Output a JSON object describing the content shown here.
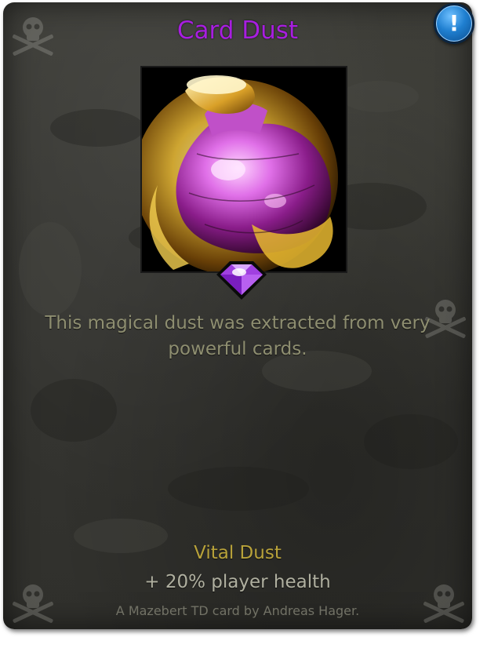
{
  "card": {
    "title": "Card Dust",
    "description": "This magical dust was extracted from very powerful cards.",
    "effect_name": "Vital Dust",
    "effect_description": "+ 20% player health",
    "credit": "A Mazebert TD card by Andreas Hager."
  },
  "info_button": {
    "label": "!",
    "icon": "exclamation-icon"
  },
  "icons": {
    "art": "potion-flask-icon",
    "rarity": "purple-gem-icon",
    "corners": "skull-crossbones-icon"
  },
  "colors": {
    "title": "#a81ee0",
    "description": "#8e8e70",
    "effect_name": "#b8a23a",
    "effect_description": "#b0b0a0",
    "credit": "#727266",
    "card_background": "#353531",
    "info_button": "#1f7fd0",
    "gem": "#a040e0"
  }
}
